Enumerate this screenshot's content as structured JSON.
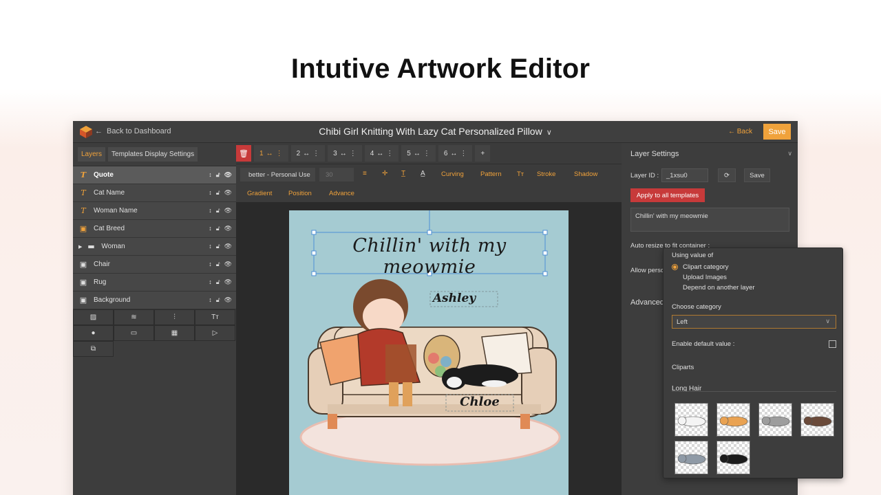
{
  "headline": "Intutive Artwork Editor",
  "topbar": {
    "back_to_dashboard": "Back to Dashboard",
    "title": "Chibi Girl Knitting With Lazy Cat Personalized Pillow",
    "back": "Back",
    "save": "Save"
  },
  "left_panel": {
    "tabs": [
      "Layers",
      "Templates Display Settings"
    ],
    "layers": [
      {
        "label": "Quote",
        "icon": "text-icon"
      },
      {
        "label": "Cat Name",
        "icon": "text-icon"
      },
      {
        "label": "Woman Name",
        "icon": "text-icon"
      },
      {
        "label": "Cat Breed",
        "icon": "image-icon"
      },
      {
        "label": "Woman",
        "icon": "folder-icon"
      },
      {
        "label": "Chair",
        "icon": "image-icon"
      },
      {
        "label": "Rug",
        "icon": "image-icon"
      },
      {
        "label": "Background",
        "icon": "image-icon"
      }
    ],
    "add_text_glyph": "Tт"
  },
  "toolbar": {
    "positions": [
      "1",
      "2",
      "3",
      "4",
      "5",
      "6"
    ],
    "font": "better - Personal Use",
    "font_size": "30",
    "options_row1": [
      "Curving",
      "Pattern",
      "Stroke",
      "Shadow"
    ],
    "options_row2": [
      "Gradient",
      "Position",
      "Advance"
    ]
  },
  "canvas": {
    "quote": "Chillin' with my meowmie",
    "woman_name": "Ashley",
    "cat_name": "Chloe"
  },
  "layer_settings": {
    "title": "Layer Settings",
    "layer_id_label": "Layer ID :",
    "layer_id_value": "_1xsu0",
    "save": "Save",
    "apply_all": "Apply to all templates",
    "text_value": "Chillin' with my meowmie",
    "auto_resize": "Auto resize to fit container :",
    "allow_person": "Allow perso",
    "advanced": "Advanced"
  },
  "popup": {
    "using_value_of": "Using value of",
    "options": [
      "Clipart category",
      "Upload Images",
      "Depend on another layer"
    ],
    "choose_category": "Choose category",
    "category_value": "Left",
    "enable_default": "Enable default value :",
    "cliparts": "Cliparts",
    "group": "Long Hair",
    "clipart_colors": [
      "#f4f4f4",
      "#e9a252",
      "#9d9d9d",
      "#6a4a3a",
      "#8f9aa6",
      "#1c1c1c"
    ]
  },
  "colors": {
    "accent": "#f0a23b",
    "danger": "#c73a3a",
    "canvas_bg": "#a5cbd2"
  }
}
